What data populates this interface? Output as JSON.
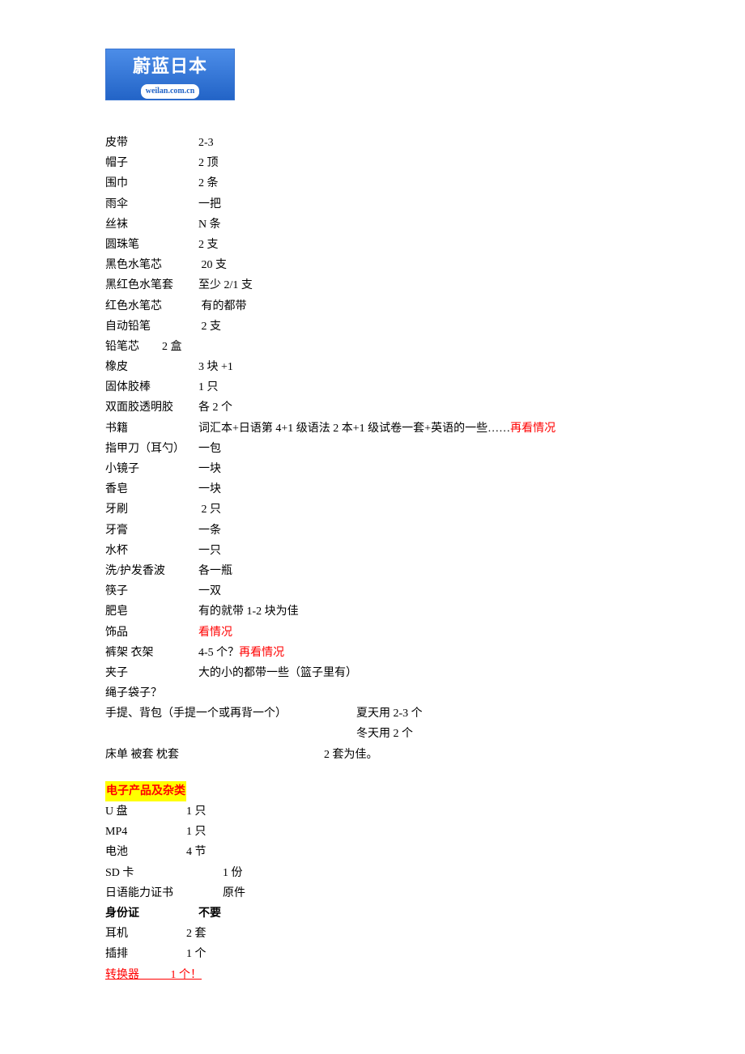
{
  "logo": {
    "top": "蔚蓝日本",
    "bottom": "weilan.com.cn"
  },
  "items1": [
    {
      "label": "皮带",
      "val": "2-3"
    },
    {
      "label": "帽子",
      "val": "2 顶"
    },
    {
      "label": "围巾",
      "val": "2 条"
    },
    {
      "label": "雨伞",
      "val": "一把"
    },
    {
      "label": "丝袜",
      "val": "N 条"
    },
    {
      "label": "圆珠笔",
      "val": "2 支"
    },
    {
      "label": "黑色水笔芯",
      "val": " 20 支"
    },
    {
      "label": "黑红色水笔套",
      "val": "至少 2/1 支"
    },
    {
      "label": "红色水笔芯",
      "val": " 有的都带"
    },
    {
      "label": "自动铅笔",
      "val": " 2 支"
    }
  ],
  "pencil_lead": {
    "label": "铅笔芯",
    "val": "2 盒"
  },
  "items2": [
    {
      "label": "橡皮",
      "val": "3 块 +1"
    },
    {
      "label": "固体胶棒",
      "val": "1 只"
    },
    {
      "label": "双面胶透明胶",
      "val": "各 2 个"
    }
  ],
  "books": {
    "label": "书籍",
    "val": "词汇本+日语第 4+1 级语法 2 本+1 级试卷一套+英语的一些……",
    "suffix": "再看情况"
  },
  "items3": [
    {
      "label": "指甲刀（耳勺）",
      "val": "一包",
      "labelw": "115"
    },
    {
      "label": "小镜子",
      "val": "一块"
    },
    {
      "label": "香皂",
      "val": "一块"
    },
    {
      "label": "牙刷",
      "val": " 2 只"
    },
    {
      "label": "牙膏",
      "val": "一条"
    },
    {
      "label": "水杯",
      "val": "一只"
    },
    {
      "label": "洗/护发香波",
      "val": "各一瓶"
    },
    {
      "label": "筷子",
      "val": "一双"
    },
    {
      "label": "肥皂",
      "val": "有的就带 1-2 块为佳"
    }
  ],
  "accessories": {
    "label": "饰品",
    "val": "看情况"
  },
  "hanger": {
    "label": "裤架 衣架",
    "prefix": "4-5 个？",
    "suffix": "再看情况"
  },
  "clips": {
    "label": "夹子",
    "val": "大的小的都带一些（篮子里有）"
  },
  "rope": {
    "label": "绳子袋子？"
  },
  "bags": {
    "line1_left": "手提、背包（手提一个或再背一个）",
    "line1_right": "夏天用 2-3 个",
    "line2": "冬天用 2 个"
  },
  "bed": {
    "label": "床单 被套 枕套",
    "val": "2 套为佳。"
  },
  "section2_header": "电子产品及杂类",
  "items4": [
    {
      "label": "U 盘",
      "val": "1 只"
    },
    {
      "label": "MP4",
      "val": "1 只"
    },
    {
      "label": "电池",
      "val": "4 节"
    }
  ],
  "sd": {
    "label": "SD 卡",
    "val": "1 份"
  },
  "cert": {
    "label": "日语能力证书",
    "val": "原件"
  },
  "idcard": {
    "label": "身份证",
    "val": "不要"
  },
  "items5": [
    {
      "label": "耳机",
      "val": "2 套"
    },
    {
      "label": "插排",
      "val": "1 个"
    }
  ],
  "converter": {
    "label": "转换器           ",
    "val": "1 个！"
  }
}
